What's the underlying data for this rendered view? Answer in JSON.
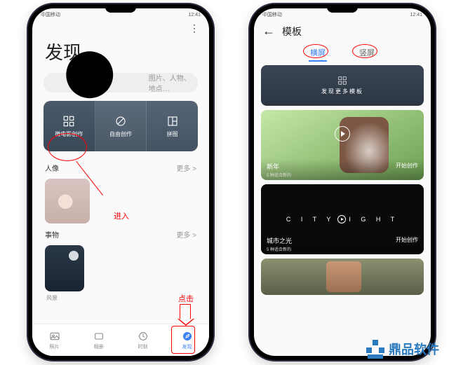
{
  "status": {
    "left": "中国移动",
    "right_time": "12:41"
  },
  "left_phone": {
    "title": "发现",
    "search_placeholder": "图片、人物、地点…",
    "cats": [
      {
        "label": "微电影创作"
      },
      {
        "label": "自由创作"
      },
      {
        "label": "拼图"
      }
    ],
    "sections": {
      "people": {
        "title": "人像",
        "more": "更多 >"
      },
      "things": {
        "title": "事物",
        "more": "更多 >",
        "cap": "风景"
      }
    },
    "annot": {
      "enter": "进入",
      "click": "点击"
    },
    "nav": [
      {
        "label": "照片"
      },
      {
        "label": "相册"
      },
      {
        "label": "时刻"
      },
      {
        "label": "发现"
      }
    ]
  },
  "right_phone": {
    "header": "模板",
    "tabs": {
      "a": "横屏",
      "b": "竖屏"
    },
    "card1": "发现更多模板",
    "card2": {
      "title": "新年",
      "sub": "5 种适合新的",
      "action": "开始创作"
    },
    "card3": {
      "logo_a": "C I T Y",
      "logo_b": "I G H T",
      "title": "城市之光",
      "sub": "5 种适合新的",
      "action": "开始创作"
    }
  },
  "brand": "鼎品软件"
}
